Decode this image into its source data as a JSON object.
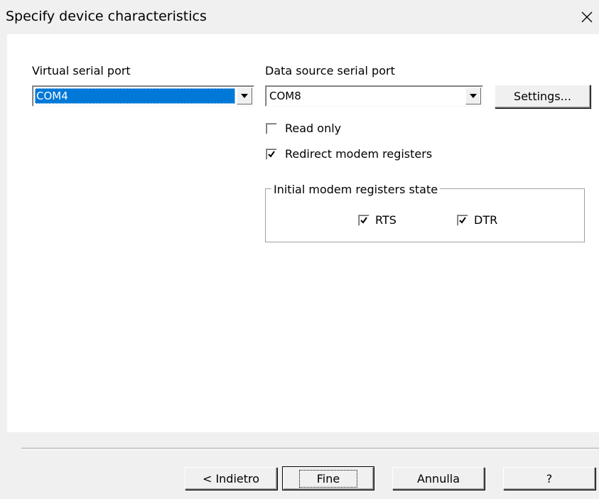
{
  "window": {
    "title": "Specify device characteristics",
    "close_icon": "close-icon"
  },
  "virtual_port": {
    "label": "Virtual serial port",
    "value": "COM4"
  },
  "data_source": {
    "label": "Data source serial port",
    "value": "COM8",
    "settings_label": "Settings..."
  },
  "options": {
    "read_only": {
      "label": "Read only",
      "checked": false
    },
    "redirect_modem": {
      "label": "Redirect modem registers",
      "checked": true
    }
  },
  "modem_group": {
    "title": "Initial modem registers state",
    "rts": {
      "label": "RTS",
      "checked": true
    },
    "dtr": {
      "label": "DTR",
      "checked": true
    }
  },
  "footer": {
    "back_label": "< Indietro",
    "finish_label": "Fine",
    "cancel_label": "Annulla",
    "help_label": "?"
  },
  "colors": {
    "selection": "#0078d7",
    "panel": "#ffffff",
    "chrome": "#f0f0f0"
  }
}
